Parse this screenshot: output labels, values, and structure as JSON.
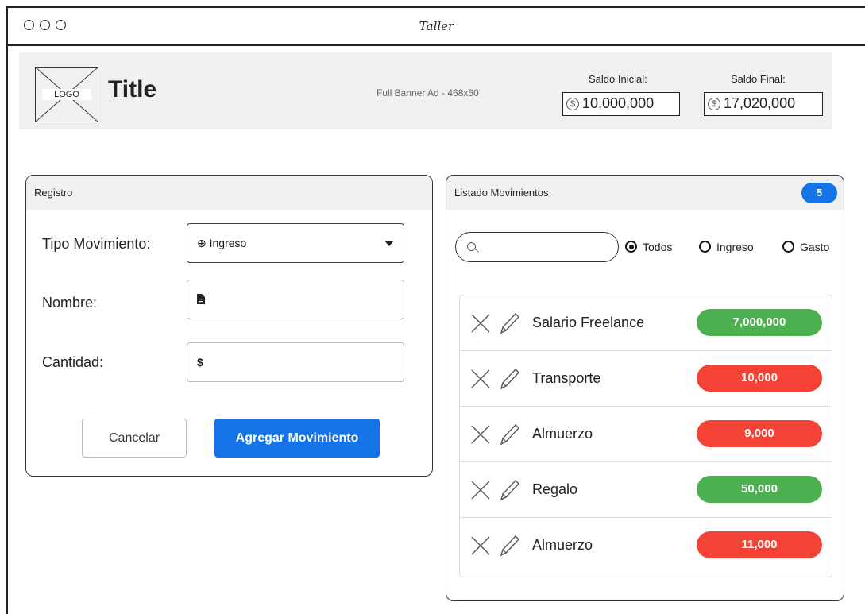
{
  "window": {
    "title": "Taller"
  },
  "header": {
    "logo_text": "LOGO",
    "title": "Title",
    "banner": "Full Banner Ad - 468x60",
    "saldo_inicial_label": "Saldo Inicial:",
    "saldo_inicial_value": "10,000,000",
    "saldo_final_label": "Saldo Final:",
    "saldo_final_value": "17,020,000",
    "coin_glyph": "$"
  },
  "registro": {
    "title": "Registro",
    "tipo_label": "Tipo Movimiento:",
    "tipo_value": "⊕ Ingreso",
    "nombre_label": "Nombre:",
    "cantidad_label": "Cantidad:",
    "cantidad_prefix": "$",
    "cancel_label": "Cancelar",
    "add_label": "Agregar Movimiento"
  },
  "listado": {
    "title": "Listado Movimientos",
    "count": "5",
    "filters": {
      "todos": "Todos",
      "ingreso": "Ingreso",
      "gasto": "Gasto",
      "selected": "Todos"
    },
    "items": [
      {
        "name": "Salario Freelance",
        "amount": "7,000,000",
        "type": "ingreso"
      },
      {
        "name": "Transporte",
        "amount": "10,000",
        "type": "gasto"
      },
      {
        "name": "Almuerzo",
        "amount": "9,000",
        "type": "gasto"
      },
      {
        "name": "Regalo",
        "amount": "50,000",
        "type": "ingreso"
      },
      {
        "name": "Almuerzo",
        "amount": "11,000",
        "type": "gasto"
      }
    ]
  },
  "colors": {
    "accent": "#1473e6",
    "ingreso": "#4caf50",
    "gasto": "#f44336"
  }
}
